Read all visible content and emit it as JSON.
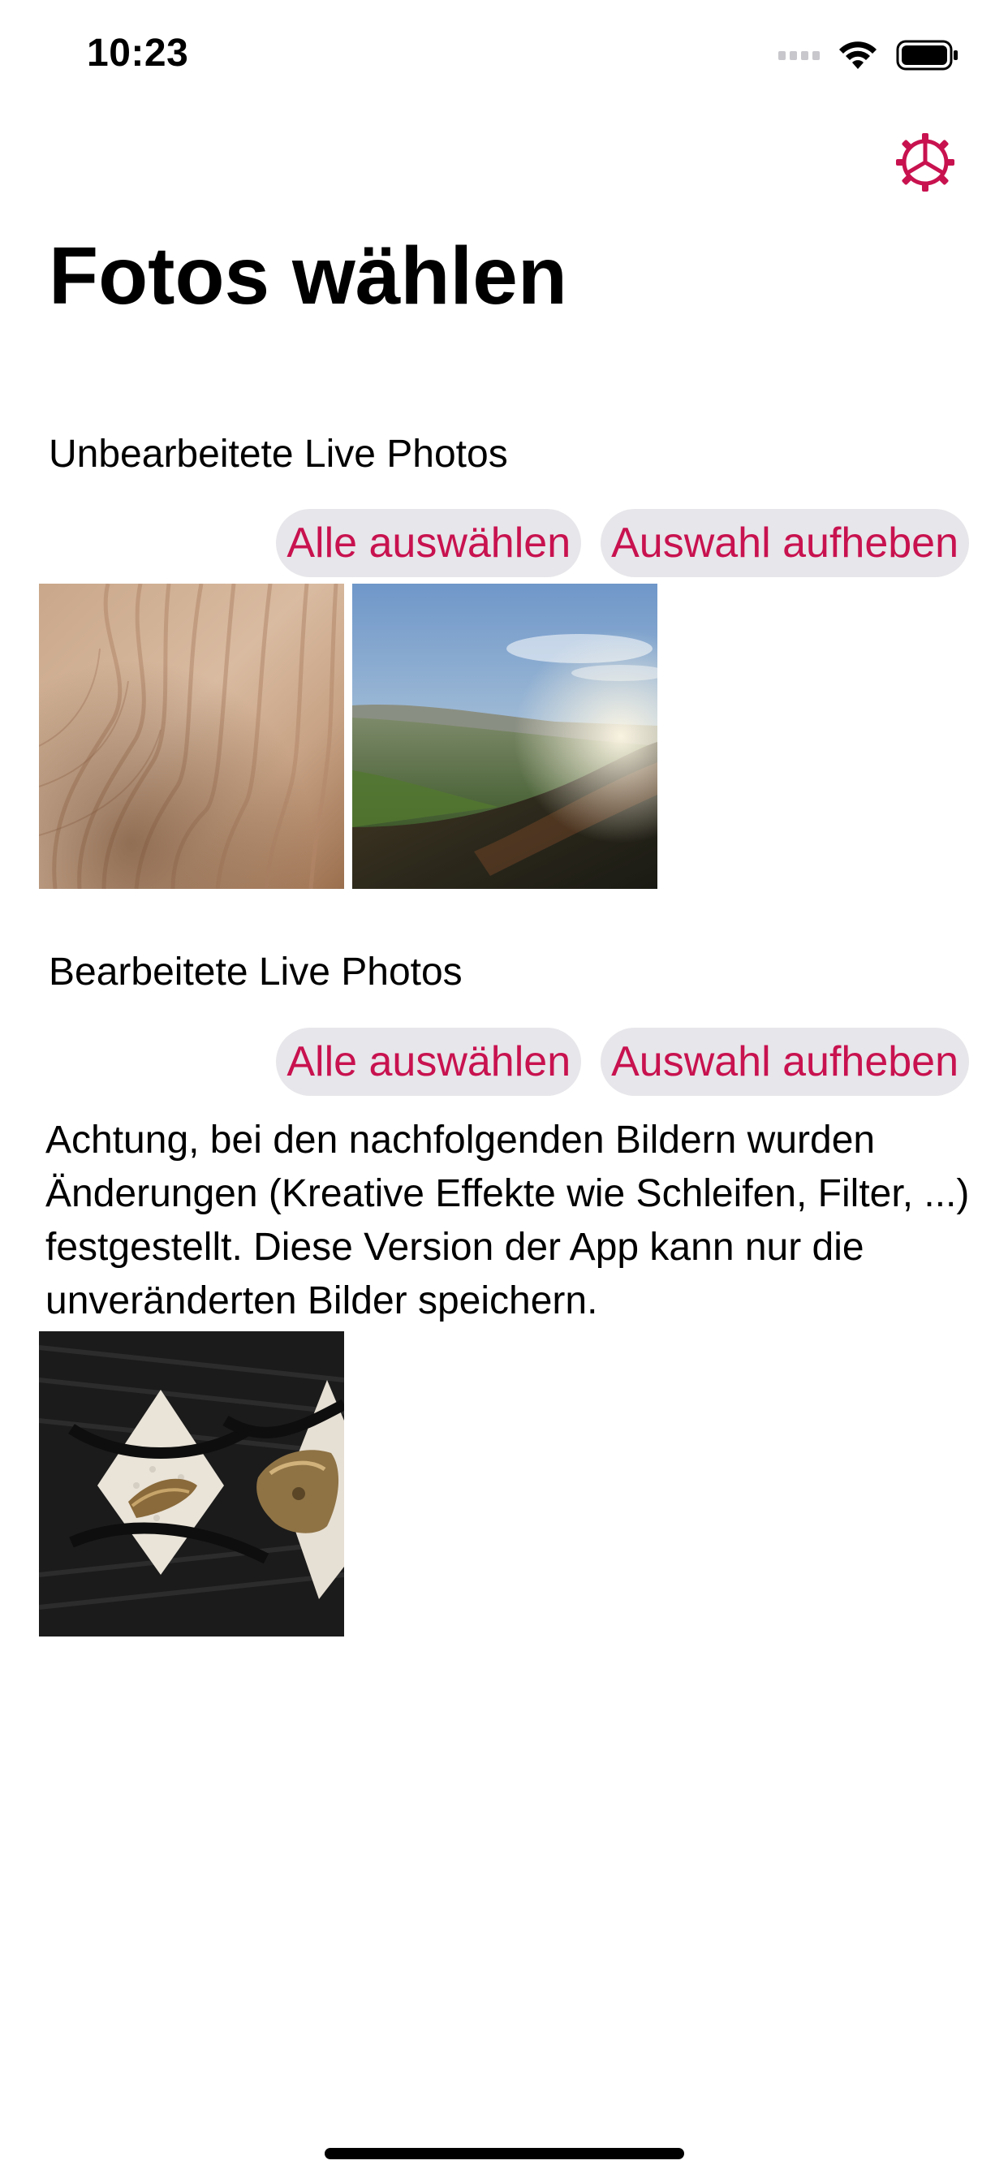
{
  "status_bar": {
    "time": "10:23"
  },
  "settings": {
    "icon": "gear-icon",
    "accent_color": "#c8124f"
  },
  "title": "Fotos wählen",
  "sections": {
    "unedited": {
      "heading": "Unbearbeitete Live Photos",
      "select_all": "Alle auswählen",
      "deselect": "Auswahl aufheben",
      "photos": [
        {
          "name": "wood-grain-photo"
        },
        {
          "name": "landscape-photo"
        }
      ]
    },
    "edited": {
      "heading": "Bearbeitete Live Photos",
      "select_all": "Alle auswählen",
      "deselect": "Auswahl aufheben",
      "notice": "Achtung, bei den nachfolgenden Bildern wurden Änderungen (Kreative Effekte wie Schleifen, Filter, ...) festgestellt. Diese Version der App kann nur die unveränderten Bilder speichern.",
      "photos": [
        {
          "name": "knit-fabric-photo"
        }
      ]
    }
  },
  "colors": {
    "accent": "#c8124f",
    "pill_background": "#e7e6ea"
  }
}
